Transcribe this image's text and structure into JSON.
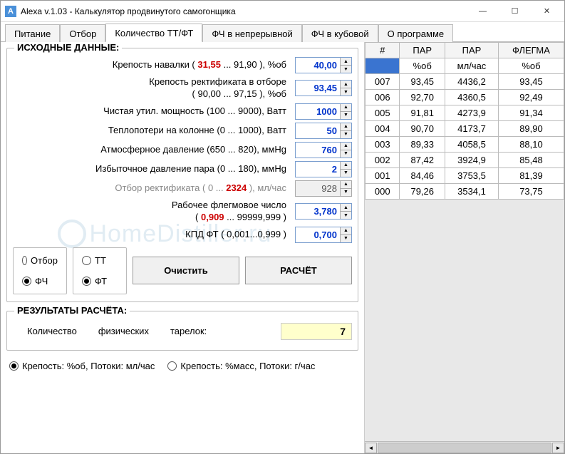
{
  "title": "Alexa  v.1.03 - Калькулятор продвинутого самогонщика",
  "tabs": [
    "Питание",
    "Отбор",
    "Количество ТТ/ФТ",
    "ФЧ в непрерывной",
    "ФЧ в кубовой",
    "О программе"
  ],
  "active_tab": 2,
  "group_source": "ИСХОДНЫЕ ДАННЫЕ:",
  "group_result": "РЕЗУЛЬТАТЫ РАСЧЁТА:",
  "labels": {
    "strength_fill_pre": "Крепость навалки (",
    "strength_fill_min": "31,55",
    "strength_fill_mid": "  ...      ",
    "strength_fill_max": "91,90",
    "strength_fill_post": "   ), %об",
    "strength_rect_line1": "Крепость ректификата в отборе",
    "strength_rect_line2_pre": "(          90,00    ... 97,15  ), %об",
    "power": "Чистая утил. мощность (100 ... 9000), Ватт",
    "heatloss": "Теплопотери на колонне (0 ... 1000), Ватт",
    "atm": "Атмосферное давление (650 ... 820), ммHg",
    "overp": "Избыточное давление пара (0  ... 180), ммHg",
    "withdraw_pre": "Отбор ректификата ( 0   ...     ",
    "withdraw_red": "2324",
    "withdraw_post": "   ), мл/час",
    "reflux_line1": "Рабочее флегмовое число",
    "reflux_line2_pre": "(           ",
    "reflux_red": "0,909",
    "reflux_line2_post": "   ... 99999,999 )",
    "kpd": "КПД ФТ ( 0,001...0,999 )"
  },
  "values": {
    "strength_fill": "40,00",
    "strength_rect": "93,45",
    "power": "1000",
    "heatloss": "50",
    "atm": "760",
    "overp": "2",
    "withdraw": "928",
    "reflux": "3,780",
    "kpd": "0,700"
  },
  "radios": {
    "c1o1": "Отбор",
    "c1o2": "ФЧ",
    "c2o1": "ТТ",
    "c2o2": "ФТ",
    "c1_sel": "ФЧ",
    "c2_sel": "ФТ"
  },
  "buttons": {
    "clear": "Очистить",
    "calc": "РАСЧЁТ"
  },
  "result": {
    "label_pre": "Количество",
    "label_mid": "физических",
    "label_post": "тарелок:",
    "value": "7"
  },
  "units": {
    "opt1": "Крепость: %об, Потоки: мл/час",
    "opt2": "Крепость: %масс, Потоки: г/час",
    "sel": "opt1"
  },
  "table": {
    "headers": [
      "#",
      "ПАР",
      "ПАР",
      "ФЛЕГМА"
    ],
    "sub": [
      "",
      "%об",
      "мл/час",
      "%об"
    ],
    "rows": [
      [
        "007",
        "93,45",
        "4436,2",
        "93,45"
      ],
      [
        "006",
        "92,70",
        "4360,5",
        "92,49"
      ],
      [
        "005",
        "91,81",
        "4273,9",
        "91,34"
      ],
      [
        "004",
        "90,70",
        "4173,7",
        "89,90"
      ],
      [
        "003",
        "89,33",
        "4058,5",
        "88,10"
      ],
      [
        "002",
        "87,42",
        "3924,9",
        "85,48"
      ],
      [
        "001",
        "84,46",
        "3753,5",
        "81,39"
      ],
      [
        "000",
        "79,26",
        "3534,1",
        "73,75"
      ]
    ]
  },
  "watermark": "HomeDistiller.ru"
}
